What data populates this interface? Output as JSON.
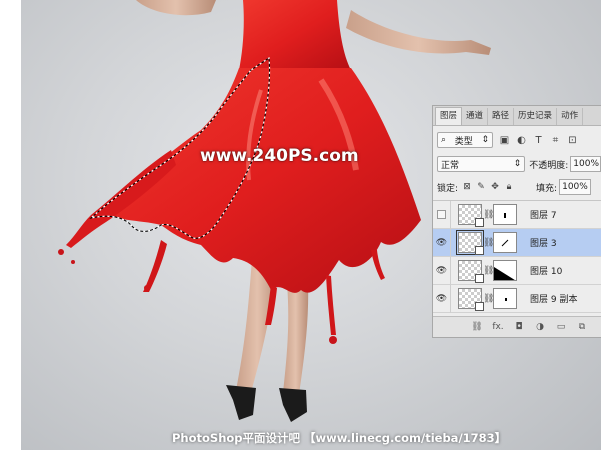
{
  "watermark": "www.240PS.com",
  "footer": "PhotoShop平面设计吧 【www.linecg.com/tieba/1783】",
  "colors": {
    "dress": "#e01e1e",
    "selection_bg": "#b6cdf2",
    "panel_bg": "#ededed"
  },
  "panel": {
    "tabs": [
      "图层",
      "通道",
      "路径",
      "历史记录",
      "动作"
    ],
    "active_tab": "图层",
    "filter": {
      "search_icon": "search-icon",
      "type_label": "类型",
      "icons": [
        "image-filter-icon",
        "adjustment-filter-icon",
        "text-filter-icon",
        "shape-filter-icon",
        "smart-object-filter-icon"
      ]
    },
    "blend_mode": "正常",
    "opacity_label": "不透明度:",
    "opacity_value": "100%",
    "lock_label": "锁定:",
    "lock_icons": [
      "lock-transparent-icon",
      "lock-paint-icon",
      "lock-move-icon",
      "lock-all-icon"
    ],
    "fill_label": "填充:",
    "fill_value": "100%",
    "layers": [
      {
        "name": "图层 7",
        "visible": false,
        "selected": false
      },
      {
        "name": "图层 3",
        "visible": true,
        "selected": true
      },
      {
        "name": "图层 10",
        "visible": true,
        "selected": false
      },
      {
        "name": "图层 9 副本",
        "visible": true,
        "selected": false
      }
    ],
    "bottom_icons": [
      "link-layers-icon",
      "fx-icon",
      "add-mask-icon",
      "adjustment-layer-icon",
      "new-group-icon",
      "new-layer-icon"
    ],
    "fx_label": "fx."
  }
}
